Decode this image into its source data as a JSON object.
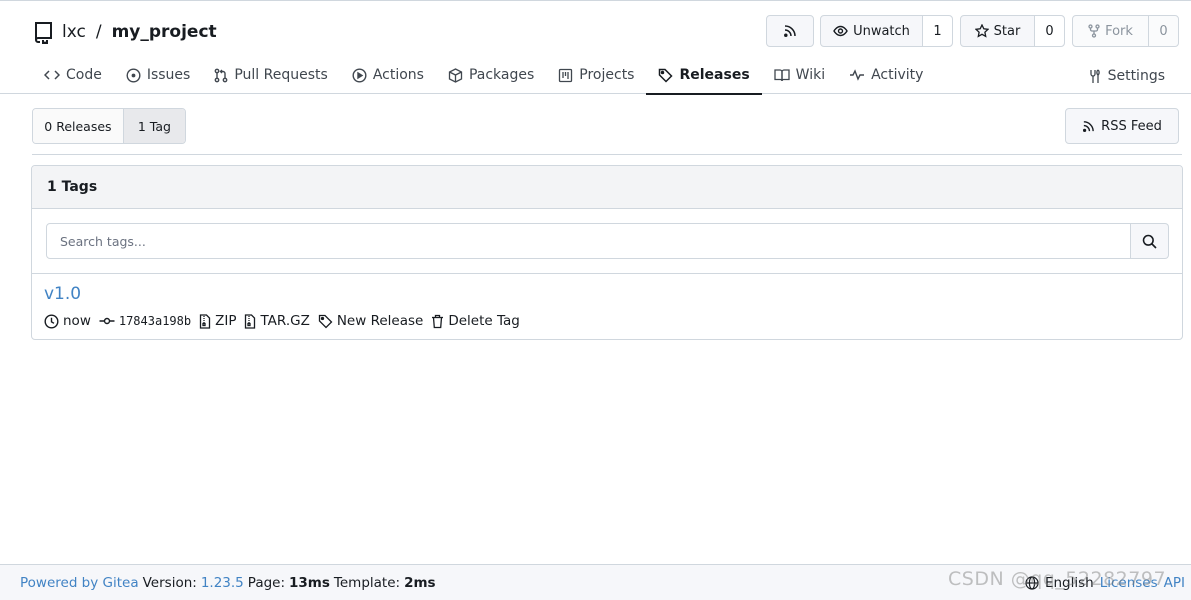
{
  "repo": {
    "owner": "lxc",
    "separator": "/",
    "name": "my_project"
  },
  "header_buttons": {
    "unwatch_label": "Unwatch",
    "unwatch_count": "1",
    "star_label": "Star",
    "star_count": "0",
    "fork_label": "Fork",
    "fork_count": "0"
  },
  "tabs": [
    {
      "label": "Code",
      "icon": "code-icon"
    },
    {
      "label": "Issues",
      "icon": "issue-icon"
    },
    {
      "label": "Pull Requests",
      "icon": "pull-request-icon"
    },
    {
      "label": "Actions",
      "icon": "play-icon"
    },
    {
      "label": "Packages",
      "icon": "package-icon"
    },
    {
      "label": "Projects",
      "icon": "project-icon"
    },
    {
      "label": "Releases",
      "icon": "tag-icon",
      "active": true
    },
    {
      "label": "Wiki",
      "icon": "book-icon"
    },
    {
      "label": "Activity",
      "icon": "pulse-icon"
    }
  ],
  "settings_label": "Settings",
  "switch": {
    "releases_label": "0 Releases",
    "tags_label": "1 Tag"
  },
  "rss_feed_label": "RSS Feed",
  "tags_panel": {
    "header": "1 Tags",
    "search_placeholder": "Search tags...",
    "tags": [
      {
        "name": "v1.0",
        "time": "now",
        "commit": "17843a198b",
        "zip_label": "ZIP",
        "targz_label": "TAR.GZ",
        "new_release_label": "New Release",
        "delete_label": "Delete Tag"
      }
    ]
  },
  "footer": {
    "powered_by": "Powered by Gitea",
    "version_label": "Version:",
    "version": "1.23.5",
    "page_label": "Page:",
    "page_time": "13ms",
    "template_label": "Template:",
    "template_time": "2ms",
    "language": "English",
    "licenses": "Licenses",
    "api": "API"
  },
  "watermark": "CSDN @qq_52282797",
  "colors": {
    "link": "#4183c4",
    "border": "#d0d7de",
    "text": "#181c21"
  }
}
